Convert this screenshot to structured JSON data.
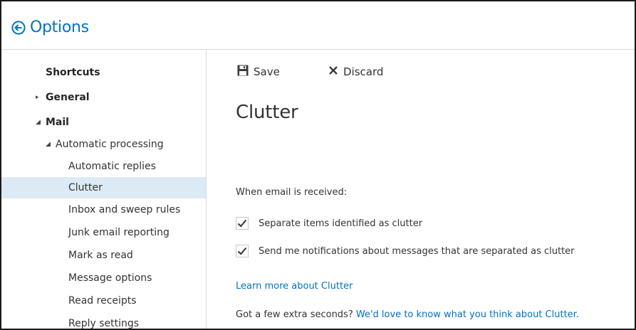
{
  "header": {
    "title": "Options"
  },
  "sidebar": {
    "items": [
      {
        "label": "Shortcuts"
      },
      {
        "label": "General"
      },
      {
        "label": "Mail"
      },
      {
        "label": "Automatic processing"
      },
      {
        "label": "Automatic replies"
      },
      {
        "label": "Clutter"
      },
      {
        "label": "Inbox and sweep rules"
      },
      {
        "label": "Junk email reporting"
      },
      {
        "label": "Mark as read"
      },
      {
        "label": "Message options"
      },
      {
        "label": "Read receipts"
      },
      {
        "label": "Reply settings"
      }
    ],
    "selected": "Clutter"
  },
  "toolbar": {
    "save_label": "Save",
    "discard_label": "Discard"
  },
  "main": {
    "title": "Clutter",
    "section_label": "When email is received:",
    "options": [
      {
        "label": "Separate items identified as clutter",
        "checked": true
      },
      {
        "label": "Send me notifications about messages that are separated as clutter",
        "checked": true
      }
    ],
    "learn_more": "Learn more about Clutter",
    "feedback_prefix": "Got a few extra seconds?",
    "feedback_link": "We'd love to know what you think about Clutter."
  },
  "colors": {
    "accent": "#0072c6",
    "selected_bg": "#dceaf6",
    "text": "#333333"
  },
  "icons": {
    "back": "circle-arrow-left-icon",
    "save": "floppy-disk-icon",
    "discard": "x-icon",
    "check": "checkmark-icon",
    "expand": "triangle-right-icon",
    "collapse": "triangle-down-icon"
  }
}
